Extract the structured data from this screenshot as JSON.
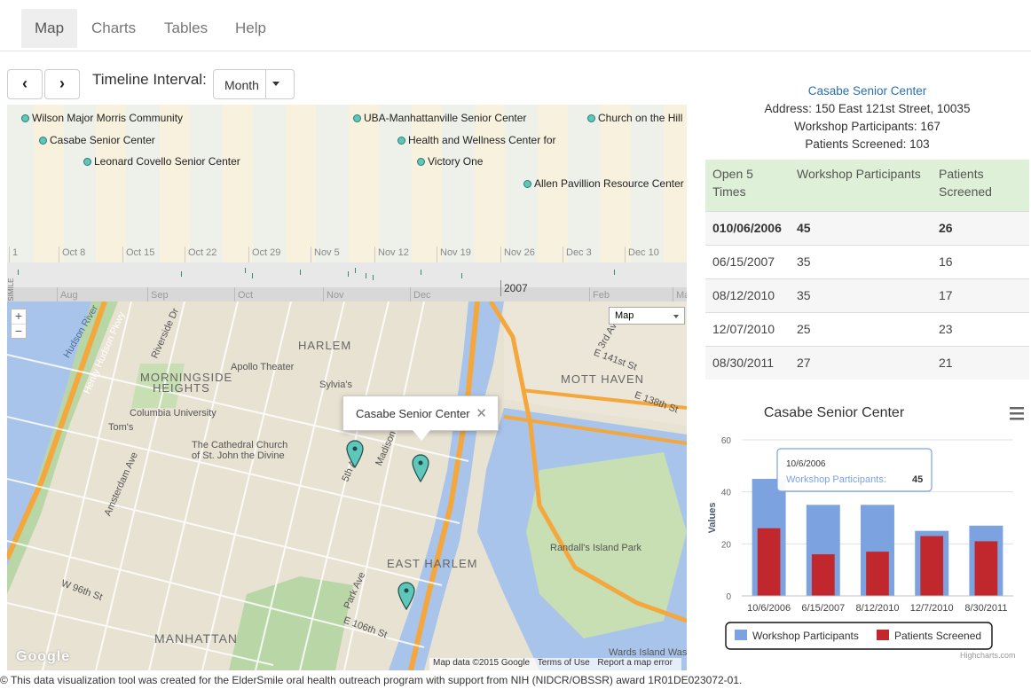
{
  "nav": {
    "tabs": [
      {
        "label": "Map",
        "active": true
      },
      {
        "label": "Charts",
        "active": false
      },
      {
        "label": "Tables",
        "active": false
      },
      {
        "label": "Help",
        "active": false
      }
    ]
  },
  "timeline_controls": {
    "prev_icon": "chevron-left-icon",
    "next_icon": "chevron-right-icon",
    "prev_glyph": "‹",
    "next_glyph": "›",
    "interval_label": "Timeline Interval:",
    "interval_value": "Month"
  },
  "timeline": {
    "events": [
      {
        "label": "Wilson Major Morris Community"
      },
      {
        "label": "Casabe Senior Center"
      },
      {
        "label": "Leonard Covello Senior Center"
      },
      {
        "label": "UBA-Manhattanville Senior Center"
      },
      {
        "label": "Health and Wellness Center for"
      },
      {
        "label": "Victory One"
      },
      {
        "label": "Church on the Hill"
      },
      {
        "label": "Allen Pavillion Resource Center"
      }
    ],
    "ticks": [
      "1",
      "Oct 8",
      "Oct 15",
      "Oct 22",
      "Oct 29",
      "Nov 5",
      "Nov 12",
      "Nov 19",
      "Nov 26",
      "Dec 3",
      "Dec 10"
    ],
    "overview_ticks": [
      "Aug",
      "Sep",
      "Oct",
      "Nov",
      "Dec",
      "Feb",
      "Ma"
    ],
    "overview_year": "2007",
    "watermark": "Timeline © SIMILE"
  },
  "map": {
    "zoom_in": "+",
    "zoom_out": "−",
    "type_value": "Map",
    "info_window_title": "Casabe Senior Center",
    "info_close": "✕",
    "labels": [
      "Hudson River",
      "Henry Hudson Pkwy",
      "Riverside Dr",
      "HARLEM",
      "Apollo Theater",
      "MORNINGSIDE",
      "HEIGHTS",
      "Sylvia's",
      "Columbia University",
      "Tom's",
      "The Cathedral Church",
      "of St. John the Divine",
      "MOTT HAVEN",
      "E 141st St",
      "E 138th St",
      "Randall's Island Park",
      "EAST HARLEM",
      "MANHATTAN",
      "W 96th St",
      "E 106th St",
      "Wards Island Wast",
      "Amsterdam Ave",
      "Madison Ave",
      "5th Ave",
      "Park Ave",
      "3rd Ave"
    ],
    "footer": {
      "data": "Map data ©2015 Google",
      "terms": "Terms of Use",
      "report": "Report a map error"
    },
    "google_logo": "Google"
  },
  "credit": "© This data visualization tool was created for the ElderSmile oral health outreach program with support from NIH (NIDCR/OBSSR) award 1R01DE023072-01.",
  "detail": {
    "name": "Casabe Senior Center",
    "address": "Address: 150 East 121st Street, 10035",
    "workshop": "Workshop Participants: 167",
    "screened": "Patients Screened: 103"
  },
  "history_table": {
    "headers": [
      "Open 5 Times",
      "Workshop Participants",
      "Patients Screened"
    ],
    "rows": [
      [
        "010/06/2006",
        "45",
        "26"
      ],
      [
        "06/15/2007",
        "35",
        "16"
      ],
      [
        "08/12/2010",
        "35",
        "17"
      ],
      [
        "12/07/2010",
        "25",
        "23"
      ],
      [
        "08/30/2011",
        "27",
        "21"
      ]
    ]
  },
  "chart_menu_icon": "hamburger-menu-icon",
  "chart_data": {
    "type": "bar",
    "title": "Casabe Senior Center",
    "ylabel": "Values",
    "xlabel": "",
    "categories": [
      "10/6/2006",
      "6/15/2007",
      "8/12/2010",
      "12/7/2010",
      "8/30/2011"
    ],
    "series": [
      {
        "name": "Workshop Participants",
        "color": "#7ca2e0",
        "values": [
          45,
          35,
          35,
          25,
          27
        ]
      },
      {
        "name": "Patients Screened",
        "color": "#c0282d",
        "values": [
          26,
          16,
          17,
          23,
          21
        ]
      }
    ],
    "ylim": [
      0,
      60
    ],
    "yticks": [
      0,
      20,
      40,
      60
    ],
    "legend_position": "bottom",
    "tooltip": {
      "category": "10/6/2006",
      "series": "Workshop Participants",
      "value": "45"
    },
    "credits": "Highcharts.com"
  }
}
